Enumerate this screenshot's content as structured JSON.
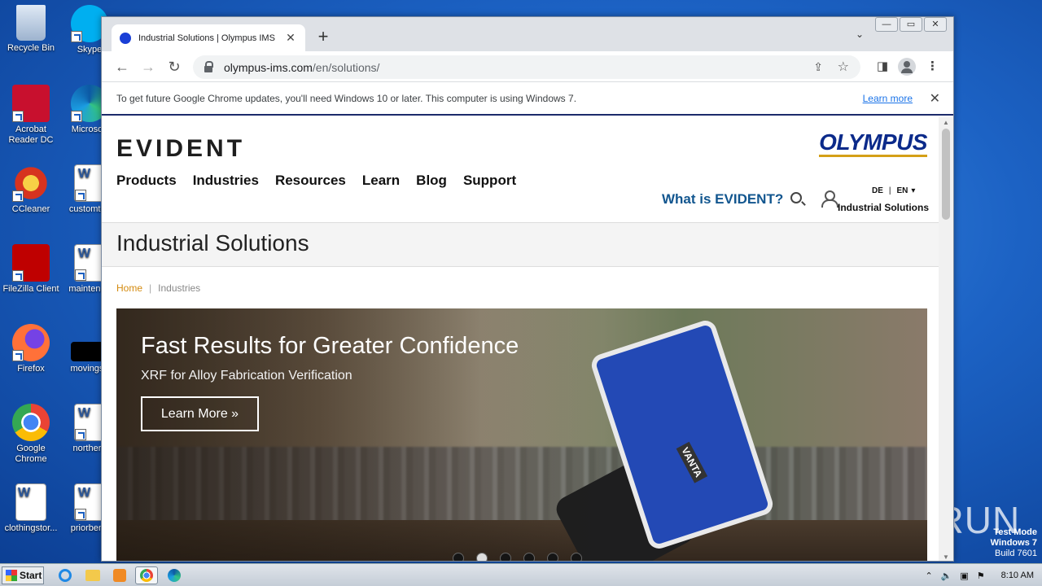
{
  "desktop": {
    "icons": [
      {
        "label": "Recycle Bin"
      },
      {
        "label": "Skype"
      },
      {
        "label": "Acrobat Reader DC"
      },
      {
        "label": "Microsoft"
      },
      {
        "label": "CCleaner"
      },
      {
        "label": "customtes"
      },
      {
        "label": "FileZilla Client"
      },
      {
        "label": "maintenan"
      },
      {
        "label": "Firefox"
      },
      {
        "label": "movingsu"
      },
      {
        "label": "Google Chrome"
      },
      {
        "label": "northern"
      },
      {
        "label": "clothingstor..."
      },
      {
        "label": "priorbene"
      }
    ],
    "watermark": "ANY RUN",
    "test_mode": {
      "line1": "Test Mode",
      "line2": "Windows 7",
      "line3": "Build 7601"
    }
  },
  "browser": {
    "tab": {
      "title": "Industrial Solutions | Olympus IMS",
      "close": "✕",
      "favicon_color": "#1a3fd6"
    },
    "new_tab": "+",
    "tab_search": "⌄",
    "window_buttons": {
      "minimize": "—",
      "maximize": "▭",
      "close": "✕"
    },
    "toolbar": {
      "back": "←",
      "forward": "→",
      "reload": "↻",
      "share": "⇪",
      "bookmark": "☆",
      "sidebar": "◨",
      "menu": "⋮"
    },
    "url": {
      "host": "olympus-ims.com",
      "path": "/en/solutions/"
    },
    "infobar": {
      "message": "To get future Google Chrome updates, you'll need Windows 10 or later. This computer is using Windows 7.",
      "learn_more": "Learn more",
      "close": "✕"
    }
  },
  "page": {
    "logo": "EVIDENT",
    "brand": "OLYMPUS",
    "nav": [
      "Products",
      "Industries",
      "Resources",
      "Learn",
      "Blog",
      "Support"
    ],
    "what_is": "What is EVIDENT?",
    "lang": {
      "de": "DE",
      "sep": "|",
      "en": "EN",
      "caret": "▾"
    },
    "region": "Industrial Solutions",
    "title": "Industrial Solutions",
    "breadcrumb": {
      "home": "Home",
      "sep": "|",
      "current": "Industries"
    },
    "hero": {
      "heading": "Fast Results for Greater Confidence",
      "subheading": "XRF for Alloy Fabrication Verification",
      "button": "Learn More »",
      "device_label": "VANTA",
      "slides": 6,
      "active_slide": 2
    },
    "colors": {
      "brand_blue": "#0b2a8a",
      "link_blue": "#12568f",
      "breadcrumb_home": "#d48a0e"
    }
  },
  "taskbar": {
    "start": "Start",
    "clock": "8:10 AM"
  }
}
